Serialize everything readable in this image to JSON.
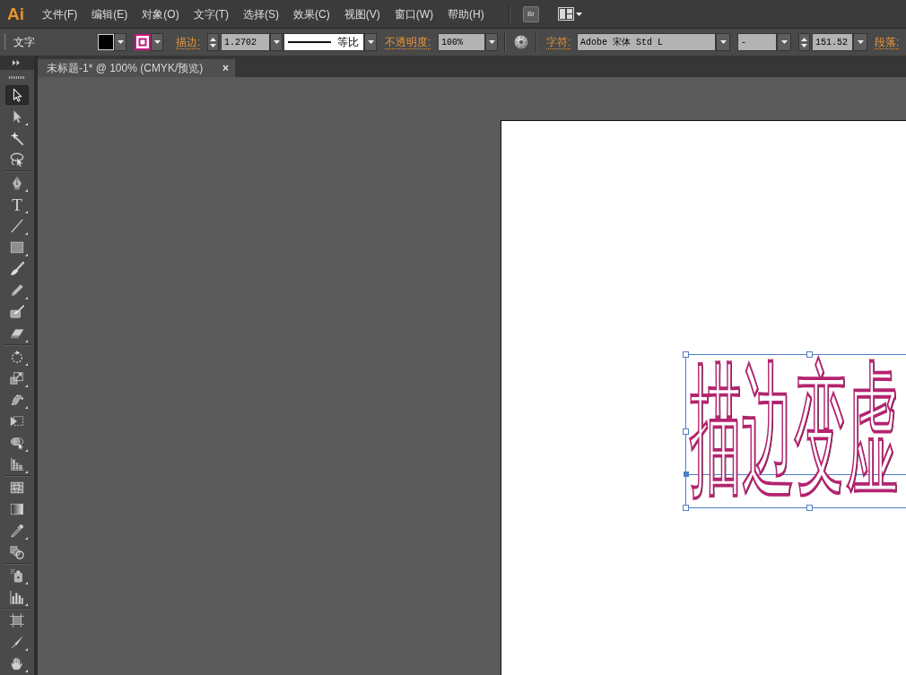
{
  "app": {
    "logo": "Ai"
  },
  "menu_bar": {
    "items": [
      "文件(F)",
      "编辑(E)",
      "对象(O)",
      "文字(T)",
      "选择(S)",
      "效果(C)",
      "视图(V)",
      "窗口(W)",
      "帮助(H)"
    ],
    "bridge_button": "Br"
  },
  "control_bar": {
    "selection_label": "文字",
    "stroke_label": "描边:",
    "stroke_weight": "1.2702",
    "stroke_profile": "等比",
    "opacity_label": "不透明度:",
    "opacity": "100%",
    "character_label": "字符:",
    "font_family": "Adobe 宋体 Std L",
    "font_style": "-",
    "font_size": "151.52",
    "paragraph_label": "段落:"
  },
  "tabs": [
    {
      "title": "未标题-1* @ 100% (CMYK/预览)",
      "close": "×",
      "selected": true
    }
  ],
  "toolbar": {
    "groups": [
      {
        "tools": [
          {
            "kind": "selection",
            "selected": true,
            "flyout": false
          },
          {
            "kind": "direct",
            "selected": false,
            "flyout": true
          },
          {
            "kind": "wand",
            "selected": false,
            "flyout": false
          },
          {
            "kind": "lasso",
            "selected": false,
            "flyout": false
          }
        ]
      },
      {
        "tools": [
          {
            "kind": "pen",
            "selected": false,
            "flyout": true
          },
          {
            "kind": "type",
            "glyph": "T",
            "selected": false,
            "flyout": true
          },
          {
            "kind": "line",
            "selected": false,
            "flyout": true
          },
          {
            "kind": "rectangle",
            "selected": false,
            "flyout": true
          },
          {
            "kind": "paintbrush",
            "selected": false,
            "flyout": false
          },
          {
            "kind": "pencil",
            "selected": false,
            "flyout": true
          },
          {
            "kind": "blob",
            "selected": false,
            "flyout": false
          },
          {
            "kind": "eraser",
            "selected": false,
            "flyout": true
          }
        ]
      },
      {
        "tools": [
          {
            "kind": "rotate",
            "selected": false,
            "flyout": true
          },
          {
            "kind": "scale",
            "selected": false,
            "flyout": true
          },
          {
            "kind": "warp",
            "selected": false,
            "flyout": true
          },
          {
            "kind": "transform",
            "selected": false,
            "flyout": false
          },
          {
            "kind": "builder",
            "selected": false,
            "flyout": true
          },
          {
            "kind": "perspective",
            "selected": false,
            "flyout": true
          }
        ]
      },
      {
        "tools": [
          {
            "kind": "mesh",
            "selected": false,
            "flyout": false
          },
          {
            "kind": "gradient",
            "selected": false,
            "flyout": false
          },
          {
            "kind": "eyedropper",
            "selected": false,
            "flyout": true
          },
          {
            "kind": "blend",
            "selected": false,
            "flyout": false
          }
        ]
      },
      {
        "tools": [
          {
            "kind": "sprayer",
            "selected": false,
            "flyout": true
          },
          {
            "kind": "graph",
            "selected": false,
            "flyout": true
          }
        ]
      },
      {
        "tools": [
          {
            "kind": "artboard",
            "selected": false,
            "flyout": false
          },
          {
            "kind": "slice",
            "selected": false,
            "flyout": true
          },
          {
            "kind": "hand",
            "selected": false,
            "flyout": true
          }
        ]
      }
    ]
  },
  "artboard": {
    "text_object": {
      "text": "描边变虚",
      "selected": true
    }
  }
}
